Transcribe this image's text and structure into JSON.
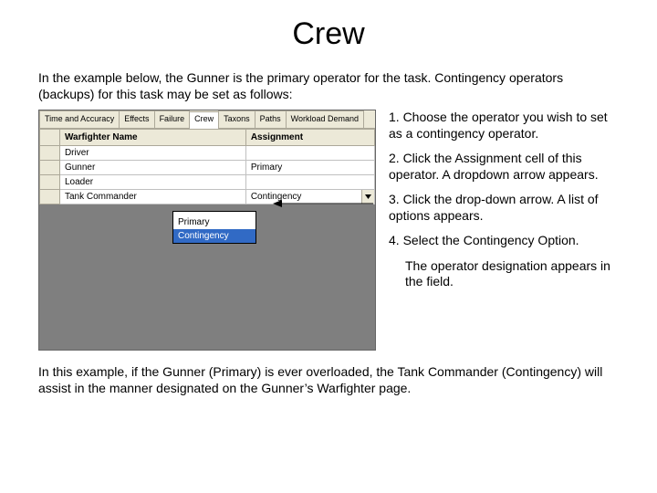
{
  "title": "Crew",
  "intro": "In the example below, the Gunner is the primary operator for the task. Contingency operators (backups) for this task may be set as follows:",
  "tabs": [
    "Time and Accuracy",
    "Effects",
    "Failure",
    "Crew",
    "Taxons",
    "Paths",
    "Workload Demand"
  ],
  "grid": {
    "col1": "Warfighter Name",
    "col2": "Assignment",
    "rows": [
      {
        "name": "Driver",
        "assign": ""
      },
      {
        "name": "Gunner",
        "assign": "Primary"
      },
      {
        "name": "Loader",
        "assign": ""
      },
      {
        "name": "Tank Commander",
        "assign": "Contingency"
      }
    ]
  },
  "dropdown": {
    "opt_blank": "",
    "opt_primary": "Primary",
    "opt_contingency": "Contingency"
  },
  "steps": {
    "s1": "1.  Choose the operator you wish to set as a contingency operator.",
    "s2": "2.  Click the Assignment cell of this operator. A dropdown arrow appears.",
    "s3": "3.  Click the drop-down arrow. A list of options appears.",
    "s4": "4.  Select the Contingency Option.",
    "s4b": "The operator designation appears in the field."
  },
  "footer": "In this example, if the Gunner (Primary) is ever overloaded, the Tank Commander (Contingency) will assist in the manner designated on the Gunner’s Warfighter page."
}
